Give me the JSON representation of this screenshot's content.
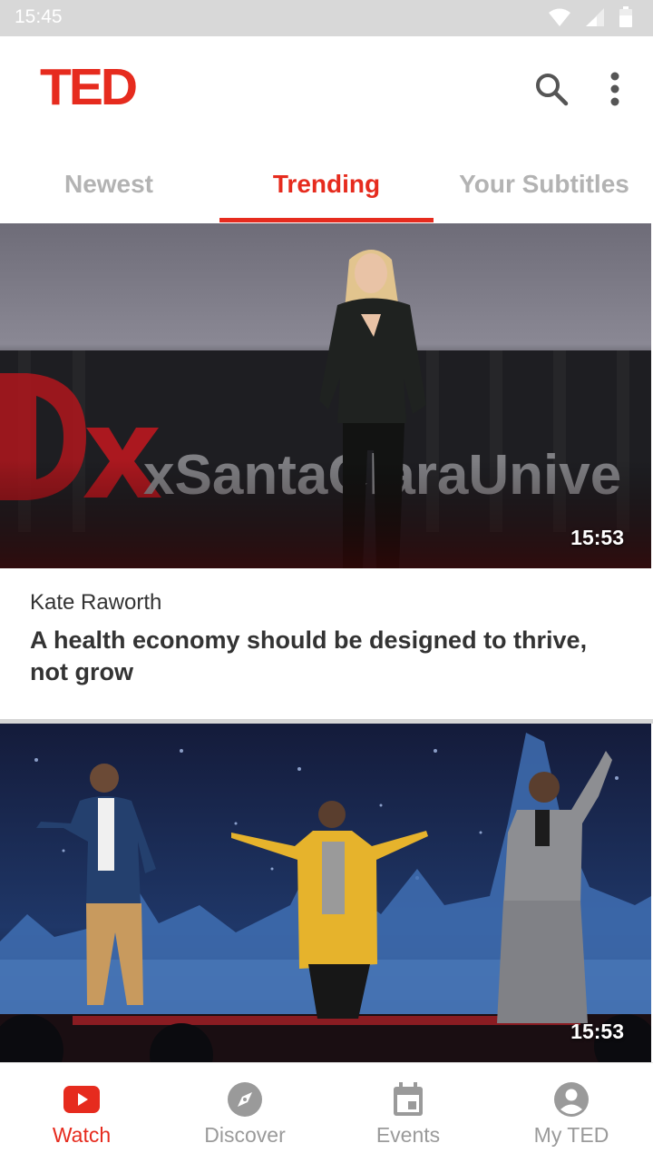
{
  "status_bar": {
    "time": "15:45"
  },
  "header": {
    "logo": "TED",
    "icons": [
      "search-icon",
      "more-vert-icon"
    ]
  },
  "tabs": [
    {
      "label": "Newest",
      "active": false
    },
    {
      "label": "Trending",
      "active": true
    },
    {
      "label": "Your Subtitles",
      "active": false
    }
  ],
  "talks": [
    {
      "duration": "15:53",
      "speaker": "Kate Raworth",
      "title": "A health economy should be designed to thrive, not grow",
      "thumbnail_text": "xSantaClaraUnive"
    },
    {
      "duration": "15:53"
    }
  ],
  "bottom_nav": [
    {
      "label": "Watch",
      "icon": "youtube-play-icon",
      "active": true
    },
    {
      "label": "Discover",
      "icon": "compass-icon",
      "active": false
    },
    {
      "label": "Events",
      "icon": "calendar-icon",
      "active": false
    },
    {
      "label": "My TED",
      "icon": "account-icon",
      "active": false
    }
  ],
  "colors": {
    "accent": "#e62b1e",
    "inactive": "#9a9a9a",
    "tab_inactive": "#b3b3b3"
  }
}
